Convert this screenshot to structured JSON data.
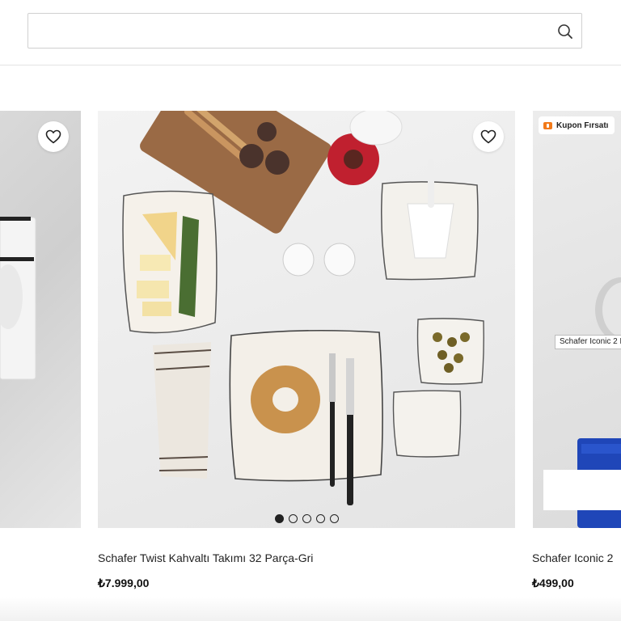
{
  "search": {
    "value": "",
    "placeholder": "",
    "icon": "search-icon"
  },
  "products": [
    {
      "title": "",
      "price": "",
      "has_favorite": true
    },
    {
      "title": "Schafer Twist Kahvaltı Takımı 32 Parça-Gri",
      "price": "₺7.999,00",
      "has_favorite": true,
      "carousel": {
        "total": 5,
        "active": 1
      }
    },
    {
      "title": "Schafer Iconic 2",
      "price": "₺499,00",
      "badge": "Kupon Fırsatı",
      "tooltip": "Schafer Iconic 2 K"
    }
  ],
  "colors": {
    "badge_accent": "#f27a1a",
    "text": "#222222",
    "border": "#d0d0d0"
  }
}
